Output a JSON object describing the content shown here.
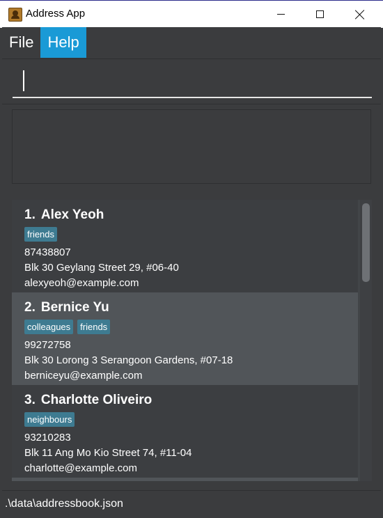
{
  "window": {
    "title": "Address App"
  },
  "menu": {
    "items": [
      {
        "label": "File"
      },
      {
        "label": "Help"
      }
    ]
  },
  "command": {
    "value": "",
    "placeholder": ""
  },
  "result": {
    "text": ""
  },
  "persons": [
    {
      "index": "1.",
      "name": "Alex Yeoh",
      "tags": [
        "friends"
      ],
      "phone": "87438807",
      "address": "Blk 30 Geylang Street 29, #06-40",
      "email": "alexyeoh@example.com"
    },
    {
      "index": "2.",
      "name": "Bernice Yu",
      "tags": [
        "colleagues",
        "friends"
      ],
      "phone": "99272758",
      "address": "Blk 30 Lorong 3 Serangoon Gardens, #07-18",
      "email": "berniceyu@example.com"
    },
    {
      "index": "3.",
      "name": "Charlotte Oliveiro",
      "tags": [
        "neighbours"
      ],
      "phone": "93210283",
      "address": "Blk 11 Ang Mo Kio Street 74, #11-04",
      "email": "charlotte@example.com"
    }
  ],
  "status": {
    "file_path": ".\\data\\addressbook.json"
  },
  "colors": {
    "accent": "#1a9ad6",
    "tag": "#3e7b91",
    "background": "#3b3c3e"
  }
}
